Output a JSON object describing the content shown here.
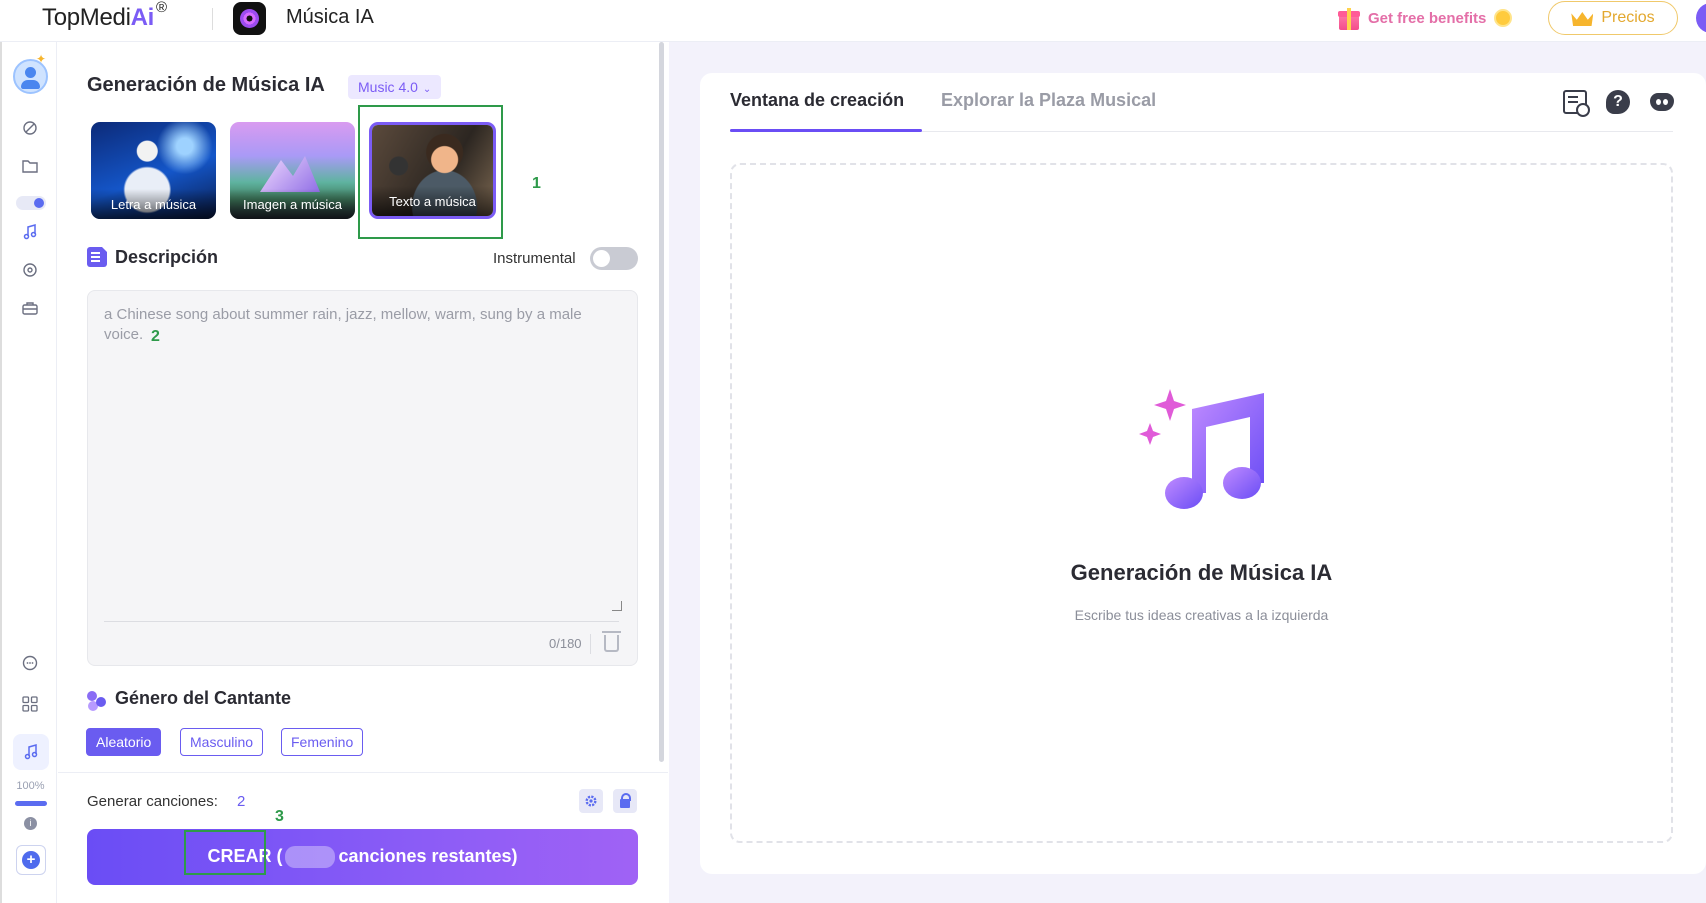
{
  "header": {
    "logo_text": "TopMedi",
    "logo_ai": "Ai",
    "logo_mark": "®",
    "app_title": "Música IA",
    "benefits_label": "Get free benefits",
    "pricing_label": "Precios"
  },
  "sidebar": {
    "zoom_percent": "100%",
    "items": [
      {
        "icon": "magic-icon"
      },
      {
        "icon": "folder-icon"
      },
      {
        "icon": "music-note-icon"
      },
      {
        "icon": "disc-icon"
      },
      {
        "icon": "briefcase-icon"
      },
      {
        "icon": "chat-icon"
      },
      {
        "icon": "apps-grid-icon"
      }
    ]
  },
  "left_panel": {
    "title": "Generación de Música IA",
    "version": "Music 4.0",
    "modes": [
      {
        "label": "Letra a música"
      },
      {
        "label": "Imagen a música"
      },
      {
        "label": "Texto a música",
        "selected": true
      }
    ],
    "description": {
      "title": "Descripción",
      "instrumental_label": "Instrumental",
      "instrumental_on": false,
      "placeholder": "a Chinese song about summer rain, jazz, mellow, warm, sung by a male voice.",
      "char_count": "0/180"
    },
    "singer_gender": {
      "title": "Género del Cantante",
      "options": [
        "Aleatorio",
        "Masculino",
        "Femenino"
      ],
      "selected": "Aleatorio"
    },
    "generate": {
      "label": "Generar canciones:",
      "value": "2"
    },
    "create_button": {
      "label": "CREAR (",
      "suffix": "canciones restantes)"
    }
  },
  "annotations": [
    "1",
    "2",
    "3"
  ],
  "right_panel": {
    "tabs": [
      "Ventana de creación",
      "Explorar la Plaza Musical"
    ],
    "active_tab": "Ventana de creación",
    "empty_title": "Generación de Música IA",
    "empty_subtitle": "Escribe tus ideas creativas a la izquierda"
  },
  "colors": {
    "accent": "#6a4df5",
    "annotation": "#2e9a4a",
    "pricing": "#e3a82e"
  }
}
